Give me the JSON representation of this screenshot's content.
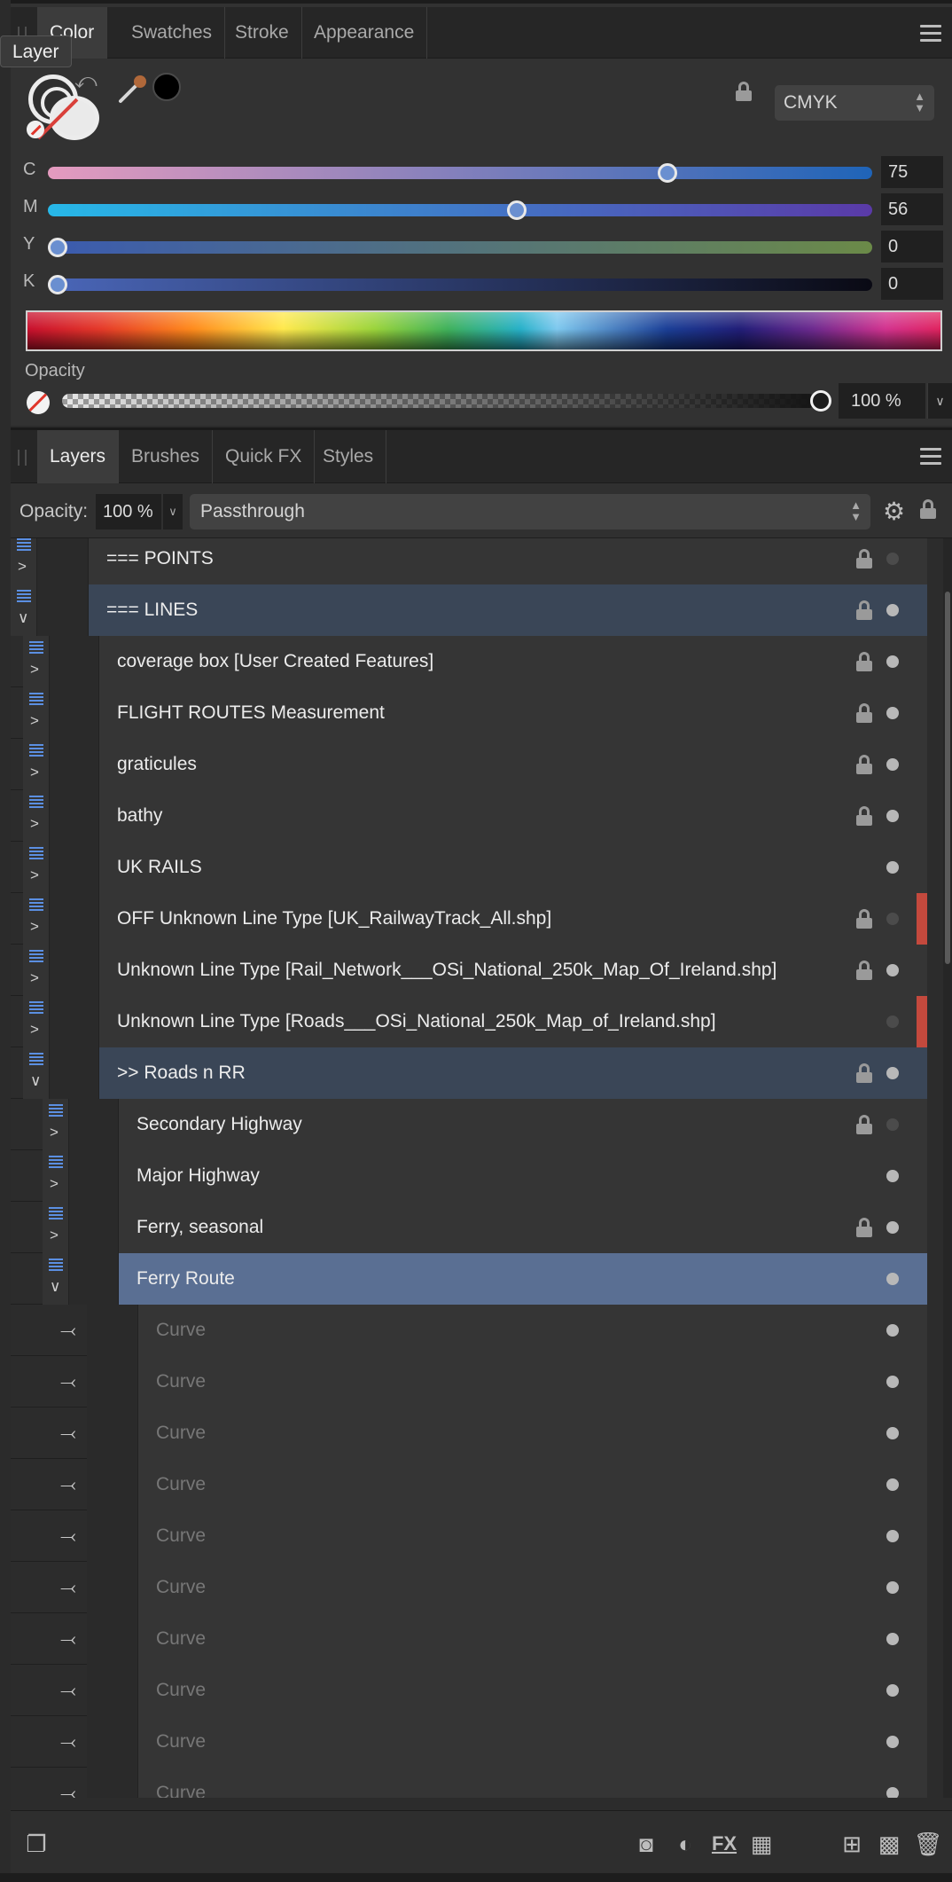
{
  "color_panel": {
    "tabs": [
      "Color",
      "Swatches",
      "Stroke",
      "Appearance"
    ],
    "tooltip": "Layer",
    "color_mode": "CMYK",
    "sliders": [
      {
        "label": "C",
        "value": "75"
      },
      {
        "label": "M",
        "value": "56"
      },
      {
        "label": "Y",
        "value": "0"
      },
      {
        "label": "K",
        "value": "0"
      }
    ],
    "opacity_label": "Opacity",
    "opacity_value": "100 %"
  },
  "layers_panel": {
    "tabs": [
      "Layers",
      "Brushes",
      "Quick FX",
      "Styles"
    ],
    "opacity_label": "Opacity:",
    "opacity_value": "100 %",
    "blend_mode": "Passthrough",
    "layers": [
      {
        "name": "=== POINTS",
        "level": 0,
        "locked": true,
        "visible_dot": "dim",
        "expanded": false,
        "state": "none"
      },
      {
        "name": "=== LINES",
        "level": 0,
        "locked": true,
        "visible_dot": "on",
        "expanded": true,
        "state": "selected"
      },
      {
        "name": "coverage box [User Created Features]",
        "level": 1,
        "locked": true,
        "visible_dot": "on",
        "expanded": false,
        "state": "none"
      },
      {
        "name": "FLIGHT ROUTES Measurement",
        "level": 1,
        "locked": true,
        "visible_dot": "on",
        "expanded": false,
        "state": "none"
      },
      {
        "name": "graticules",
        "level": 1,
        "locked": true,
        "visible_dot": "on",
        "expanded": false,
        "state": "none"
      },
      {
        "name": "bathy",
        "level": 1,
        "locked": true,
        "visible_dot": "on",
        "expanded": false,
        "state": "none"
      },
      {
        "name": "UK RAILS",
        "level": 1,
        "locked": false,
        "visible_dot": "on",
        "expanded": false,
        "state": "none"
      },
      {
        "name": "OFF Unknown Line Type [UK_RailwayTrack_All.shp]",
        "level": 1,
        "locked": true,
        "visible_dot": "dim",
        "expanded": false,
        "state": "none",
        "flag": true
      },
      {
        "name": "Unknown Line Type [Rail_Network___OSi_National_250k_Map_Of_Ireland.shp]",
        "level": 1,
        "locked": true,
        "visible_dot": "on",
        "expanded": false,
        "state": "none"
      },
      {
        "name": "Unknown Line Type [Roads___OSi_National_250k_Map_of_Ireland.shp]",
        "level": 1,
        "locked": false,
        "visible_dot": "dim",
        "expanded": false,
        "state": "none",
        "flag": true
      },
      {
        "name": ">> Roads n RR",
        "level": 1,
        "locked": true,
        "visible_dot": "on",
        "expanded": true,
        "state": "selected"
      },
      {
        "name": "Secondary Highway",
        "level": 2,
        "locked": true,
        "visible_dot": "dim",
        "expanded": false,
        "state": "none"
      },
      {
        "name": "Major Highway",
        "level": 2,
        "locked": false,
        "visible_dot": "on",
        "expanded": false,
        "state": "none"
      },
      {
        "name": "Ferry, seasonal",
        "level": 2,
        "locked": true,
        "visible_dot": "on",
        "expanded": false,
        "state": "none"
      },
      {
        "name": "Ferry Route",
        "level": 2,
        "locked": false,
        "visible_dot": "on",
        "expanded": true,
        "state": "active"
      },
      {
        "name": "Curve",
        "level": 3,
        "locked": false,
        "visible_dot": "on",
        "curve": true
      },
      {
        "name": "Curve",
        "level": 3,
        "locked": false,
        "visible_dot": "on",
        "curve": true
      },
      {
        "name": "Curve",
        "level": 3,
        "locked": false,
        "visible_dot": "on",
        "curve": true
      },
      {
        "name": "Curve",
        "level": 3,
        "locked": false,
        "visible_dot": "on",
        "curve": true
      },
      {
        "name": "Curve",
        "level": 3,
        "locked": false,
        "visible_dot": "on",
        "curve": true
      },
      {
        "name": "Curve",
        "level": 3,
        "locked": false,
        "visible_dot": "on",
        "curve": true
      },
      {
        "name": "Curve",
        "level": 3,
        "locked": false,
        "visible_dot": "on",
        "curve": true
      },
      {
        "name": "Curve",
        "level": 3,
        "locked": false,
        "visible_dot": "on",
        "curve": true
      },
      {
        "name": "Curve",
        "level": 3,
        "locked": false,
        "visible_dot": "on",
        "curve": true
      },
      {
        "name": "Curve",
        "level": 3,
        "locked": false,
        "visible_dot": "on",
        "curve": true
      }
    ]
  },
  "icons": {
    "gear": "gear-icon",
    "lock": "lock-icon",
    "curve": "curve-icon",
    "bottom": [
      "layer-stack-icon",
      "mask-icon",
      "adjustment-icon",
      "fx-icon",
      "mesh-icon",
      "add-layer-icon",
      "pixel-layer-icon",
      "trash-icon"
    ]
  }
}
